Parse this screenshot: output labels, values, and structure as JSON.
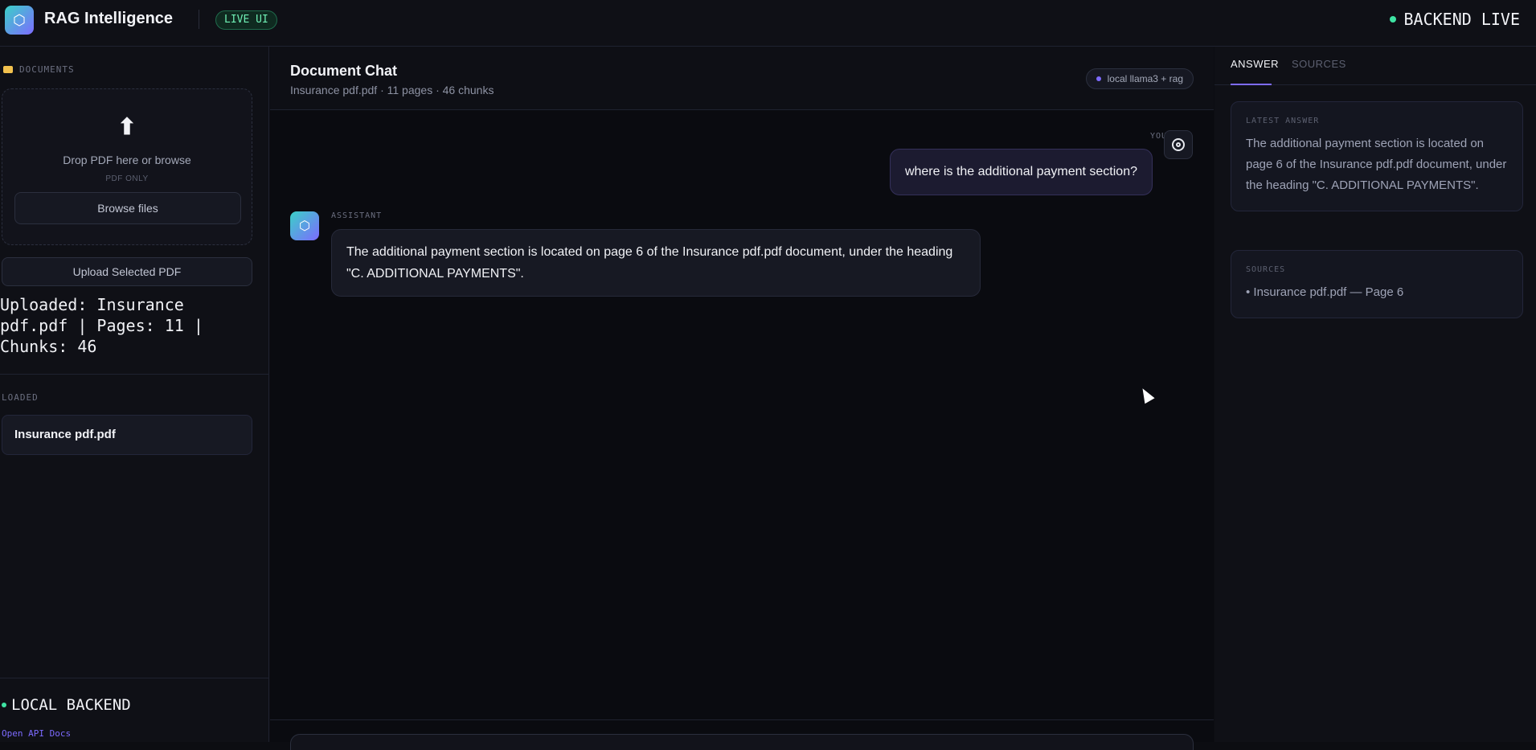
{
  "app": {
    "title": "RAG Intelligence",
    "logo_glyph": "⬡",
    "live_badge": "LIVE UI",
    "backend_status": "BACKEND LIVE"
  },
  "sidebar": {
    "documents_heading": "DOCUMENTS",
    "dropzone": {
      "arrow": "⬆",
      "text": "Drop PDF here or browse",
      "hint": "PDF ONLY",
      "browse_label": "Browse files"
    },
    "upload_label": "Upload Selected PDF",
    "upload_status": "Uploaded: Insurance pdf.pdf | Pages: 11 | Chunks: 46",
    "loaded_heading": "LOADED",
    "loaded_items": [
      "Insurance pdf.pdf"
    ],
    "backend_label": "LOCAL BACKEND",
    "api_link": "Open API Docs"
  },
  "chat": {
    "title": "Document Chat",
    "subtitle": "Insurance pdf.pdf · 11 pages · 46 chunks",
    "model_badge": "local llama3 + rag",
    "messages": [
      {
        "role_label": "YOU",
        "text": "where is the additional payment section?"
      },
      {
        "role_label": "ASSISTANT",
        "text": "The additional payment section is located on page 6 of the Insurance pdf.pdf document, under the heading \"C. ADDITIONAL PAYMENTS\"."
      }
    ]
  },
  "right_panel": {
    "tabs": [
      "ANSWER",
      "SOURCES"
    ],
    "active_tab": "ANSWER",
    "latest_answer": {
      "heading": "LATEST ANSWER",
      "text": "The additional payment section is located on page 6 of the Insurance pdf.pdf document, under the heading \"C. ADDITIONAL PAYMENTS\"."
    },
    "sources": {
      "heading": "SOURCES",
      "items": [
        "• Insurance pdf.pdf — Page 6"
      ]
    }
  },
  "colors": {
    "accent": "#7d6bff",
    "live_green": "#3ee3a3",
    "background": "#0a0b10"
  }
}
